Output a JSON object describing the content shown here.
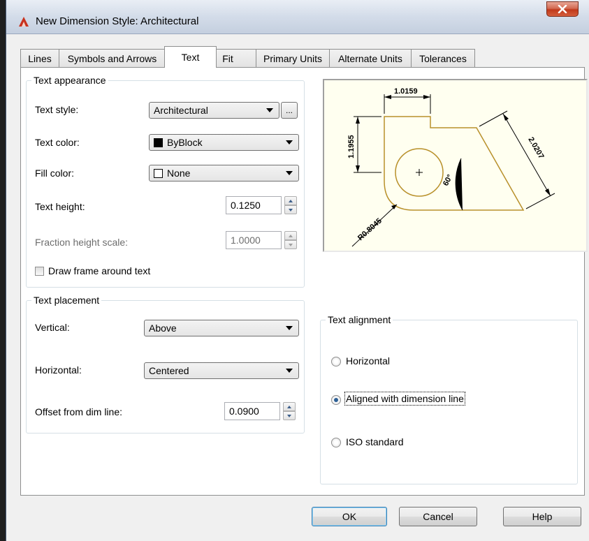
{
  "window": {
    "title": "New Dimension Style: Architectural"
  },
  "tabs": [
    {
      "label": "Lines"
    },
    {
      "label": "Symbols and Arrows"
    },
    {
      "label": "Text"
    },
    {
      "label": "Fit"
    },
    {
      "label": "Primary Units"
    },
    {
      "label": "Alternate Units"
    },
    {
      "label": "Tolerances"
    }
  ],
  "active_tab": "Text",
  "text_appearance": {
    "title": "Text appearance",
    "text_style": {
      "label": "Text style:",
      "value": "Architectural",
      "browse_label": "..."
    },
    "text_color": {
      "label": "Text color:",
      "value": "ByBlock"
    },
    "fill_color": {
      "label": "Fill color:",
      "value": "None"
    },
    "text_height": {
      "label": "Text height:",
      "value": "0.1250"
    },
    "fraction_height_scale": {
      "label": "Fraction height scale:",
      "value": "1.0000"
    },
    "draw_frame": {
      "label": "Draw frame around text",
      "checked": false
    }
  },
  "text_placement": {
    "title": "Text placement",
    "vertical": {
      "label": "Vertical:",
      "value": "Above"
    },
    "horizontal": {
      "label": "Horizontal:",
      "value": "Centered"
    },
    "offset": {
      "label": "Offset from dim line:",
      "value": "0.0900"
    }
  },
  "text_alignment": {
    "title": "Text alignment",
    "options": [
      {
        "label": "Horizontal",
        "selected": false
      },
      {
        "label": "Aligned with dimension line",
        "selected": true
      },
      {
        "label": "ISO standard",
        "selected": false
      }
    ]
  },
  "preview": {
    "labels": [
      "1.0159",
      "1.1955",
      "2.0207",
      "60°",
      "R0.8045"
    ],
    "line_color": "#b8902a"
  },
  "buttons": {
    "ok": "OK",
    "cancel": "Cancel",
    "help": "Help"
  }
}
